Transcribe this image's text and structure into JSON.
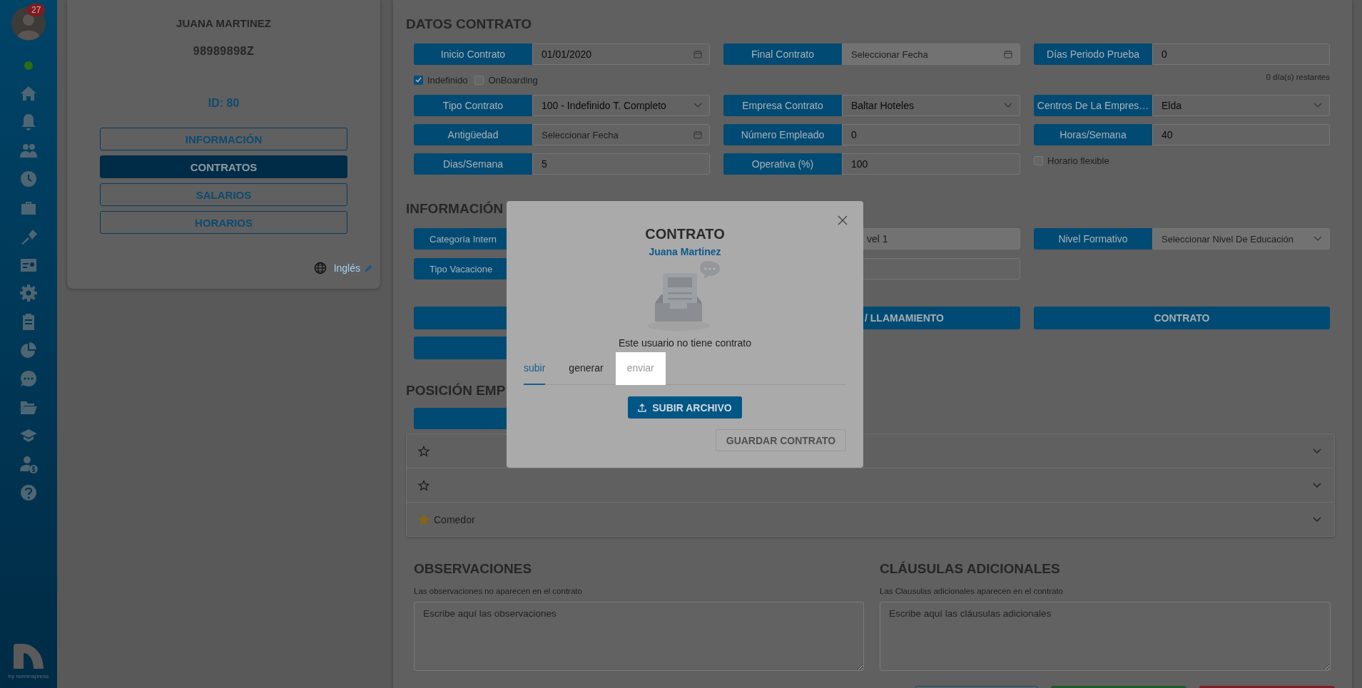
{
  "sidebar": {
    "badge": "27",
    "online": true,
    "brand": "by nominapress"
  },
  "profile": {
    "name": "JUANA MARTINEZ",
    "document": "98989898Z",
    "id": "ID: 80",
    "tabs": [
      {
        "label": "INFORMACIÓN",
        "selected": false
      },
      {
        "label": "CONTRATOS",
        "selected": true
      },
      {
        "label": "SALARIOS",
        "selected": false
      },
      {
        "label": "HORARIOS",
        "selected": false
      }
    ],
    "language": "Inglés"
  },
  "contract": {
    "title": "DATOS CONTRATO",
    "rows": [
      {
        "cells": [
          {
            "kind": "date",
            "label": "Inicio Contrato",
            "value": "01/01/2020"
          },
          {
            "kind": "date",
            "label": "Final Contrato",
            "placeholder": "Seleccionar Fecha",
            "disabled": true
          },
          {
            "kind": "text",
            "label": "Días Periodo Prueba",
            "value": "0"
          }
        ]
      },
      {
        "cells": [
          {
            "kind": "checks",
            "items": [
              {
                "label": "Indefinido",
                "checked": true
              },
              {
                "label": "OnBoarding",
                "checked": false
              }
            ]
          },
          null,
          {
            "kind": "note",
            "text": "0 día(s) restantes"
          }
        ]
      },
      {
        "cells": [
          {
            "kind": "select",
            "label": "Tipo Contrato",
            "value": "100 - Indefinido T. Completo"
          },
          {
            "kind": "select",
            "label": "Empresa Contrato",
            "value": "Baltar Hoteles"
          },
          {
            "kind": "select",
            "label": "Centros De La Empres…",
            "value": "Elda"
          }
        ]
      },
      {
        "cells": [
          {
            "kind": "date",
            "label": "Antigüedad",
            "placeholder": "Seleccionar Fecha"
          },
          {
            "kind": "text",
            "label": "Número Empleado",
            "value": "0"
          },
          {
            "kind": "text",
            "label": "Horas/Semana",
            "value": "40"
          }
        ]
      },
      {
        "cells": [
          {
            "kind": "text",
            "label": "Dias/Semana",
            "value": "5"
          },
          {
            "kind": "text",
            "label": "Operativa (%)",
            "value": "100"
          },
          {
            "kind": "checks",
            "items": [
              {
                "label": "Horario flexible",
                "checked": false
              }
            ]
          }
        ]
      }
    ]
  },
  "information": {
    "title": "INFORMACIÓN",
    "rows": [
      {
        "cells": [
          {
            "kind": "text",
            "label": "Categoría Intern"
          },
          {
            "kind": "text",
            "value": "vel 1",
            "disabled": true
          },
          {
            "kind": "select",
            "label": "Nivel Formativo",
            "placeholder": "Seleccionar Nivel De Educación",
            "disabled": true
          }
        ]
      },
      {
        "cells": [
          {
            "kind": "select",
            "label": "Tipo Vacacione"
          },
          {
            "kind": "text"
          },
          null
        ]
      }
    ],
    "actions": [
      [
        {
          "kind": "button"
        },
        {
          "kind": "button",
          "label": "/ LLAMAMIENTO"
        },
        {
          "kind": "button",
          "label": "CONTRATO"
        }
      ],
      [
        {
          "kind": "button"
        }
      ]
    ]
  },
  "position": {
    "title": "POSICIÓN EMP",
    "items": [
      {
        "starred": false
      },
      {
        "starred": false
      },
      {
        "starred": true,
        "label": "Comedor"
      }
    ]
  },
  "notes": [
    {
      "title": "OBSERVACIONES",
      "hint": "Las observaciones no aparecen en el contrato",
      "placeholder": "Escribe aquí las observaciones"
    },
    {
      "title": "CLÁUSULAS ADICIONALES",
      "hint": "Las Clausulas adicionales aparecen en el contrato",
      "placeholder": "Escribe aquí las cláusulas adicionales"
    }
  ],
  "modal": {
    "title": "CONTRATO",
    "subtitle": "Juana Martinez",
    "message": "Este usuario no tiene contrato",
    "tabs": [
      {
        "label": "subir",
        "selected": true,
        "disabled": false
      },
      {
        "label": "generar",
        "selected": false,
        "disabled": false
      },
      {
        "label": "enviar",
        "selected": false,
        "disabled": true
      }
    ],
    "upload_button": "SUBIR ARCHIVO",
    "save_button": {
      "label": "GUARDAR CONTRATO",
      "disabled": true
    }
  }
}
